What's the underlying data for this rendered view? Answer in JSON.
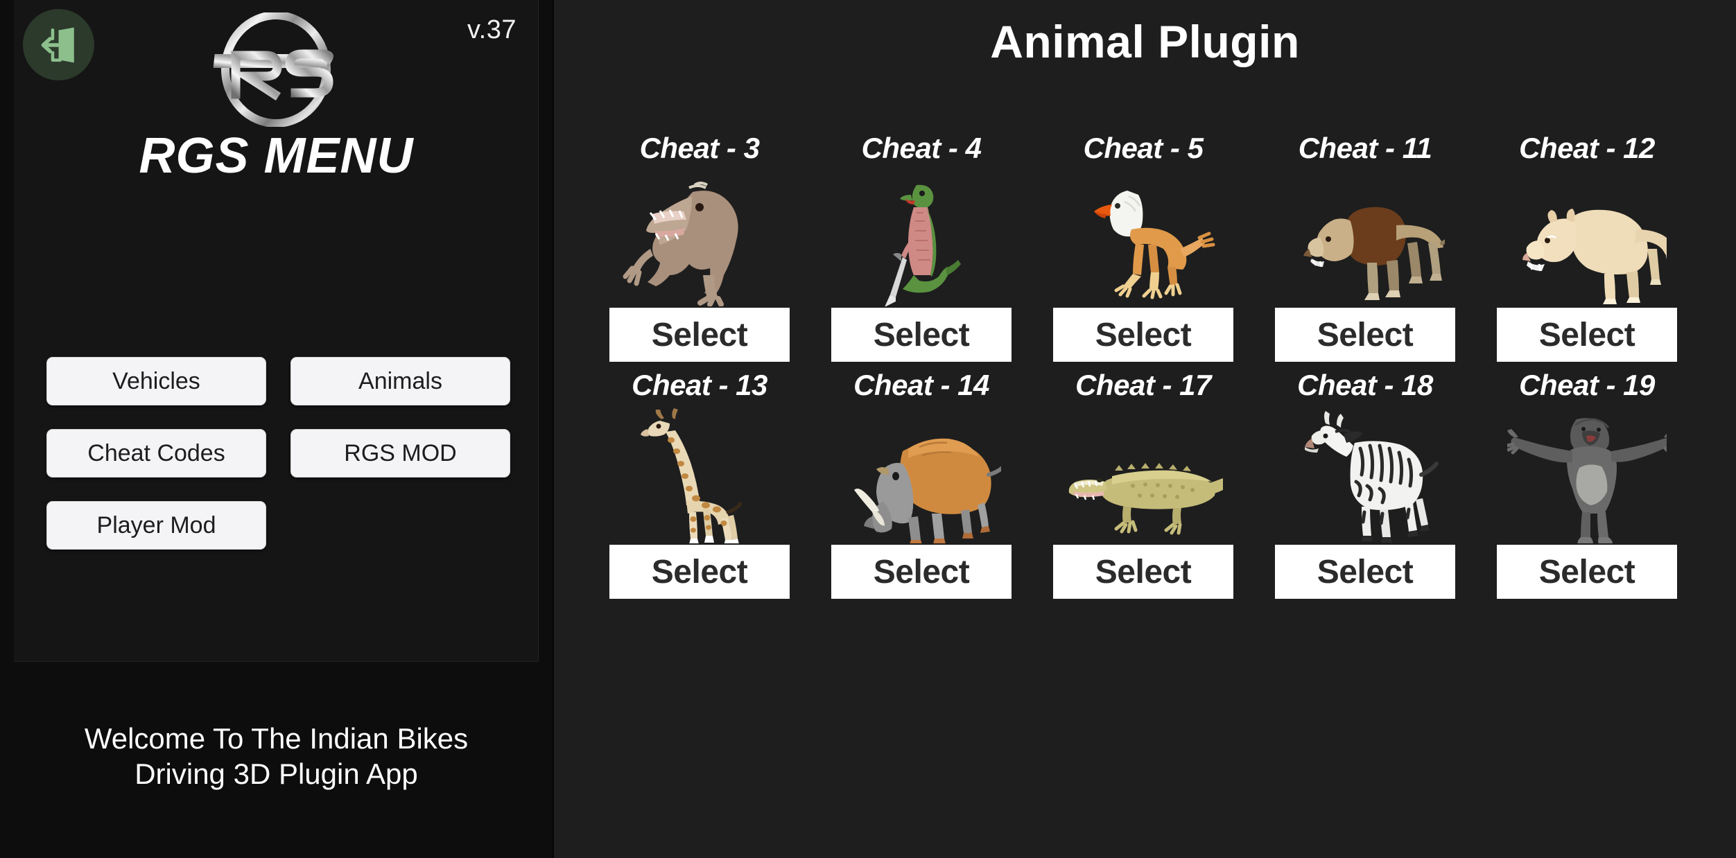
{
  "sidebar": {
    "version": "v.37",
    "exit_icon": "exit-door-arrow-icon",
    "logo": "rgs-logo",
    "menu_title": "RGS MENU",
    "buttons": [
      {
        "label": "Vehicles"
      },
      {
        "label": "Animals"
      },
      {
        "label": "Cheat Codes"
      },
      {
        "label": "RGS MOD"
      },
      {
        "label": "Player Mod"
      }
    ],
    "welcome_line1": "Welcome To The Indian Bikes",
    "welcome_line2": "Driving 3D Plugin App"
  },
  "main": {
    "title": "Animal Plugin",
    "select_label": "Select",
    "rows": [
      [
        {
          "label": "Cheat - 3",
          "creature": "dinosaur"
        },
        {
          "label": "Cheat - 4",
          "creature": "lizardman"
        },
        {
          "label": "Cheat - 5",
          "creature": "eagle-griffin"
        },
        {
          "label": "Cheat - 11",
          "creature": "lion"
        },
        {
          "label": "Cheat - 12",
          "creature": "lioness"
        }
      ],
      [
        {
          "label": "Cheat - 13",
          "creature": "giraffe"
        },
        {
          "label": "Cheat - 14",
          "creature": "rhinoceros"
        },
        {
          "label": "Cheat - 17",
          "creature": "crocodile"
        },
        {
          "label": "Cheat - 18",
          "creature": "zebra"
        },
        {
          "label": "Cheat - 19",
          "creature": "gorilla"
        }
      ]
    ]
  },
  "colors": {
    "sidebar_bg": "#0d0d0d",
    "sidebar_card": "#151515",
    "main_bg": "#1e1e1e",
    "button_bg": "#f4f4f6",
    "select_bg": "#ffffff",
    "exit_circle": "#2c3a2c",
    "exit_icon": "#8cbf8c",
    "text": "#ffffff"
  }
}
